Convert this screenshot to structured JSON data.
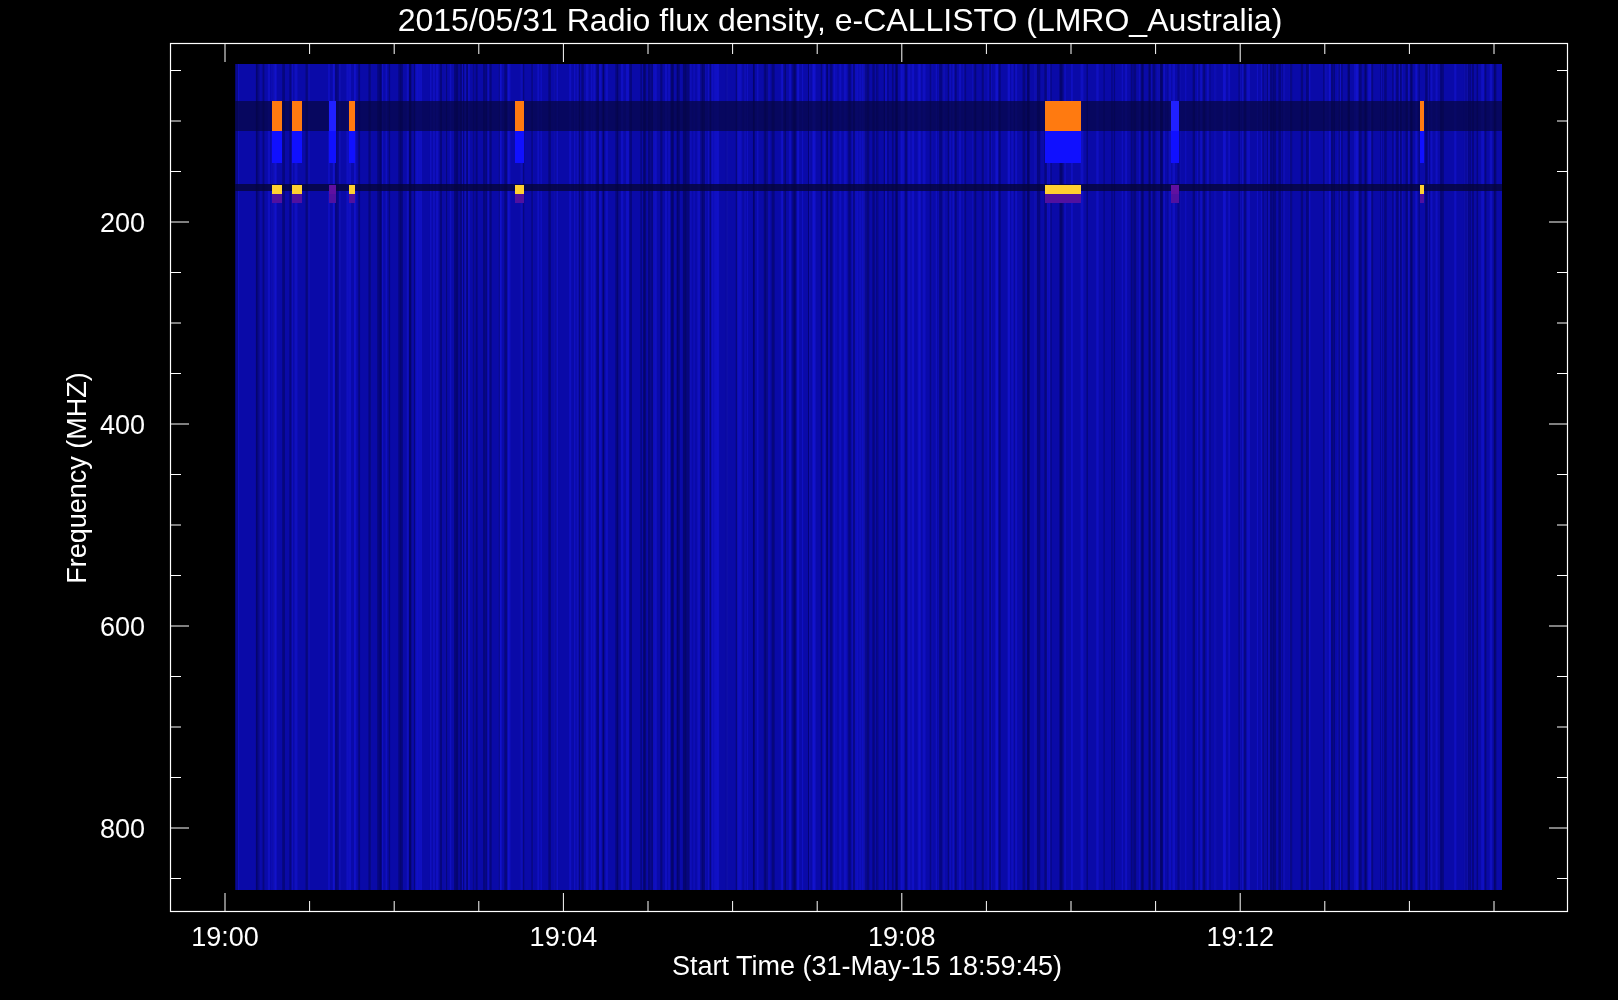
{
  "plot": {
    "title": "2015/05/31  Radio flux density, e-CALLISTO (LMRO_Australia)",
    "xlabel": "Start Time (31-May-15 18:59:45)",
    "ylabel": "Frequency (MHZ)",
    "xticks": [
      "19:00",
      "19:04",
      "19:08",
      "19:12"
    ],
    "yticks": [
      "200",
      "400",
      "600",
      "800"
    ]
  }
}
